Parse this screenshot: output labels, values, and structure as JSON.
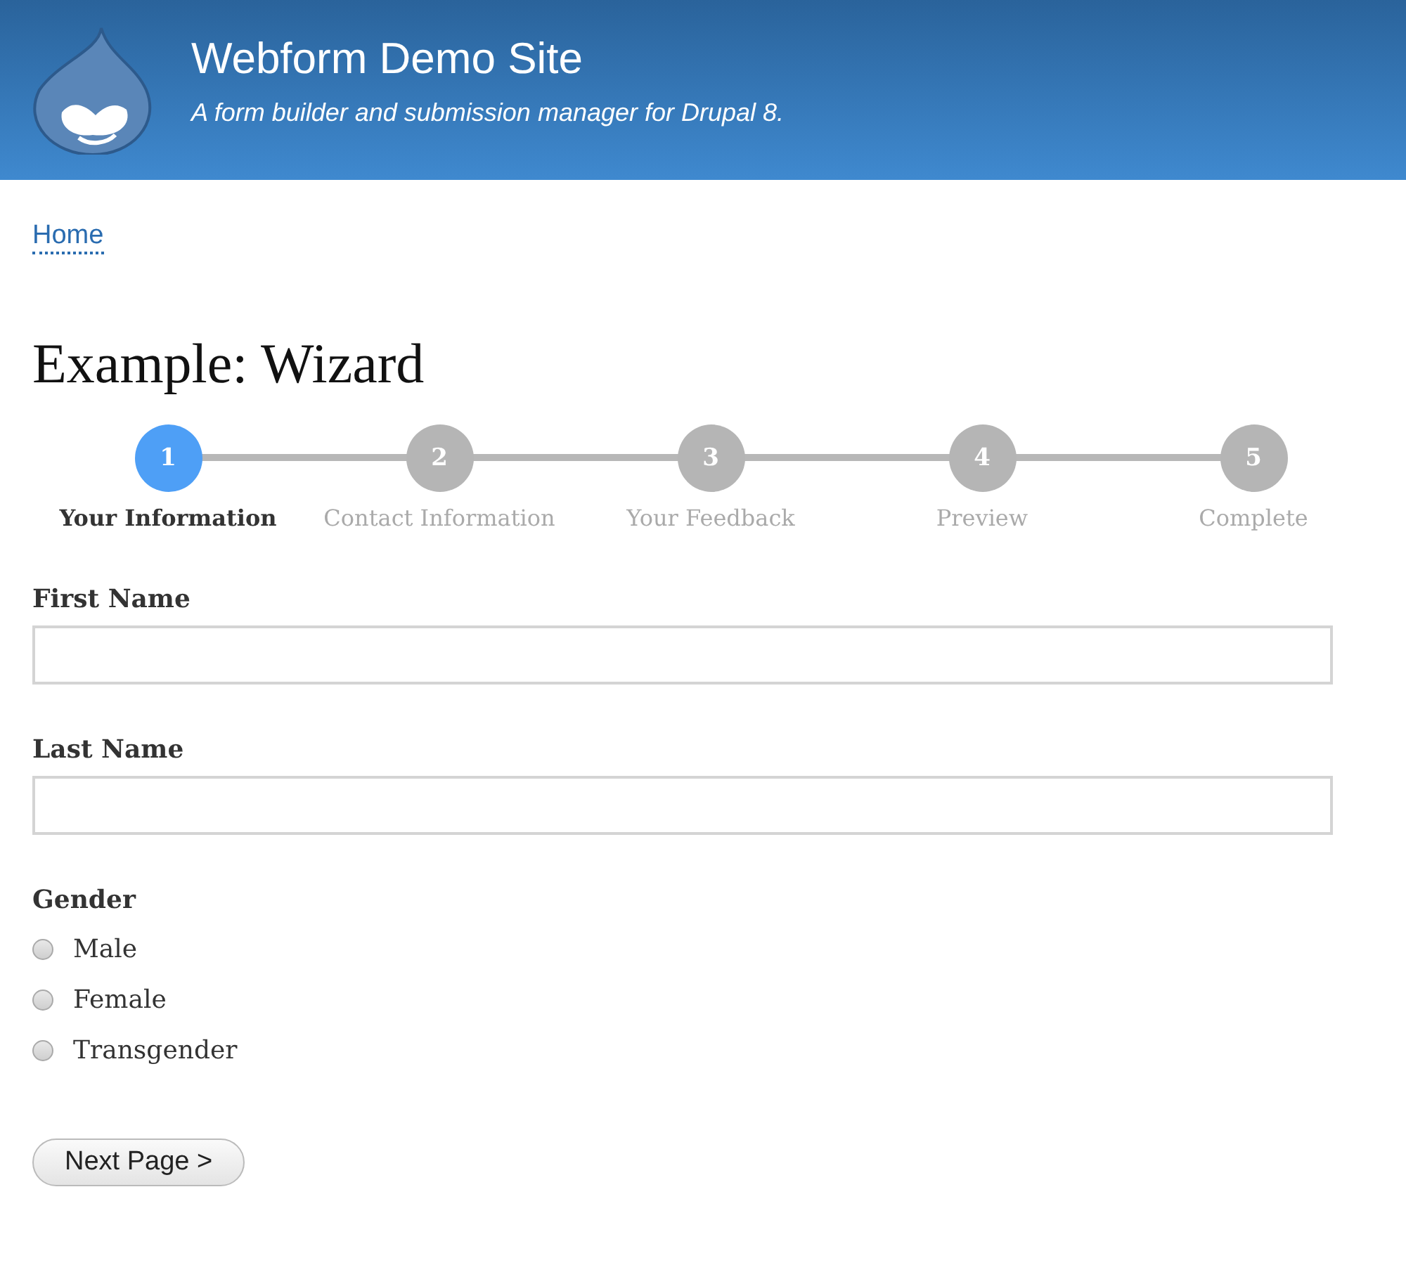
{
  "header": {
    "site_name": "Webform Demo Site",
    "slogan": "A form builder and submission manager for Drupal 8."
  },
  "breadcrumb": [
    "Home"
  ],
  "page_title": "Example: Wizard",
  "steps": [
    {
      "number": "1",
      "label": "Your Information",
      "selected": true
    },
    {
      "number": "2",
      "label": "Contact Information",
      "selected": false
    },
    {
      "number": "3",
      "label": "Your Feedback",
      "selected": false
    },
    {
      "number": "4",
      "label": "Preview",
      "selected": false
    },
    {
      "number": "5",
      "label": "Complete",
      "selected": false
    }
  ],
  "fields": [
    {
      "label": "First Name"
    },
    {
      "label": "Last Name"
    }
  ],
  "gender": {
    "label": "Gender",
    "options": [
      {
        "label": "Male",
        "selected": false
      },
      {
        "label": "Female",
        "selected": false
      },
      {
        "label": "Transgender",
        "selected": false
      }
    ]
  },
  "button": "Next Page >"
}
